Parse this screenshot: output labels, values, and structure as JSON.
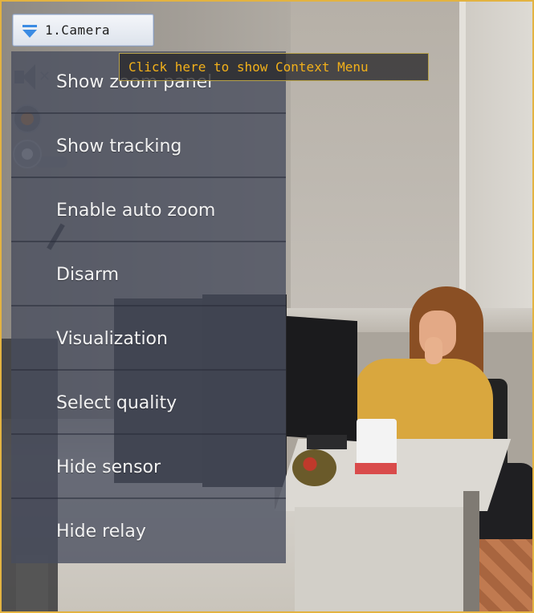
{
  "camera_button": {
    "label": "1.Camera"
  },
  "tooltip": {
    "text": "Click here to show Context Menu"
  },
  "context_menu": {
    "items": [
      {
        "label": "Show zoom panel"
      },
      {
        "label": "Show tracking"
      },
      {
        "label": "Enable auto zoom"
      },
      {
        "label": "Disarm"
      },
      {
        "label": "Visualization"
      },
      {
        "label": "Select quality"
      },
      {
        "label": "Hide sensor"
      },
      {
        "label": "Hide relay"
      }
    ]
  },
  "colors": {
    "frame_border": "#e3b341",
    "menu_background": "#484d5e",
    "menu_text": "#f2f2f2",
    "tooltip_text": "#f2b01a",
    "dropdown_arrow": "#3b8be3"
  },
  "icons": {
    "camera_button": "chevron-down-icon",
    "ptz": [
      "speaker-muted-icon",
      "record-icon",
      "joystick-icon"
    ]
  }
}
